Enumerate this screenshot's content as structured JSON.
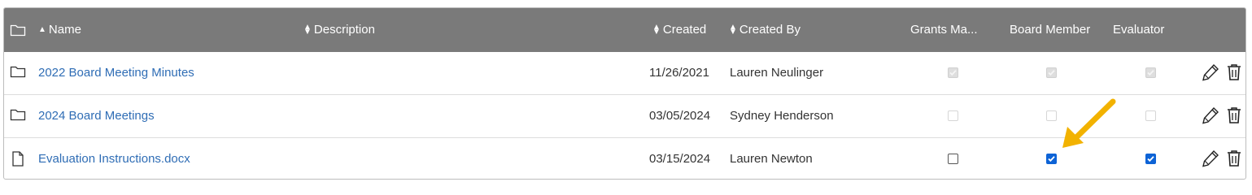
{
  "colors": {
    "header_bg": "#7a7a7a",
    "link": "#2f6db5",
    "checkbox_checked": "#0d63d6",
    "annotation_arrow": "#f2b200"
  },
  "header": {
    "folder_icon": "folder-outline-icon",
    "name": "Name",
    "description": "Description",
    "created": "Created",
    "created_by": "Created By",
    "grants": "Grants Ma...",
    "board_member": "Board Member",
    "evaluator": "Evaluator"
  },
  "rows": [
    {
      "icon": "folder-icon",
      "name": "2022 Board Meeting Minutes",
      "description": "",
      "created": "11/26/2021",
      "created_by": "Lauren Neulinger",
      "grants": "disabled-checked",
      "board_member": "disabled-checked",
      "evaluator": "disabled-checked"
    },
    {
      "icon": "folder-icon",
      "name": "2024 Board Meetings",
      "description": "",
      "created": "03/05/2024",
      "created_by": "Sydney Henderson",
      "grants": "disabled",
      "board_member": "disabled",
      "evaluator": "disabled"
    },
    {
      "icon": "file-icon",
      "name": "Evaluation Instructions.docx",
      "description": "",
      "created": "03/15/2024",
      "created_by": "Lauren Newton",
      "grants": "unchecked",
      "board_member": "checked",
      "evaluator": "checked"
    }
  ],
  "actions": {
    "edit_icon": "pencil-icon",
    "delete_icon": "trash-icon"
  }
}
